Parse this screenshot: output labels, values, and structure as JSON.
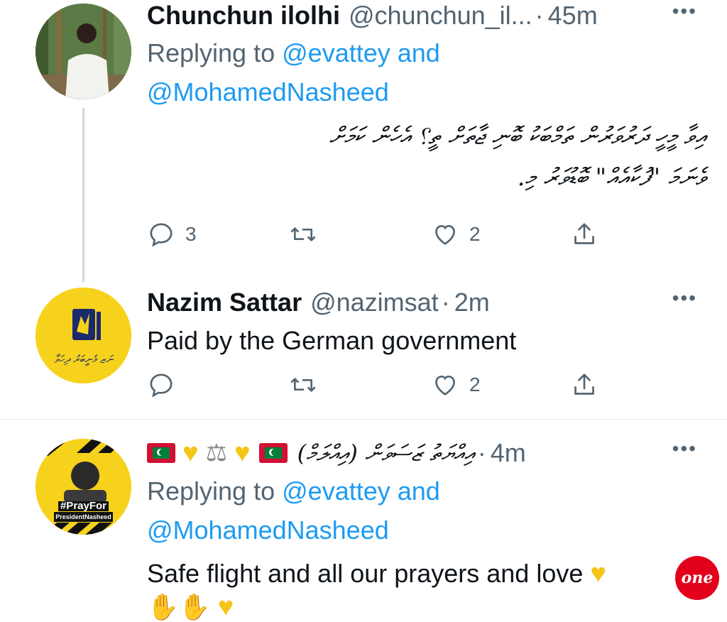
{
  "tweets": [
    {
      "name": "Chunchun ilolhi",
      "handle": "@chunchun_il...",
      "time": "45m",
      "replying_prefix": "Replying to",
      "replying_user1": "@evattey",
      "replying_and": "and",
      "replying_user2": "@MohamedNasheed",
      "text_line1": "އިވާ މީހީ ދަރުވަރުން ތަމްބަކު ބޮނި ޖާތަށް ތީ؟ އެހެން ކަމަށް",
      "text_line2": "ވެނަމަ \"ފުކާއެއް\" ބޮޑުވަރު މި.",
      "replies": "3",
      "retweets": "",
      "likes": "2"
    },
    {
      "name": "Nazim Sattar",
      "handle": "@nazimsat",
      "time": "2m",
      "text": "Paid by the German government",
      "avatar_text": "ނަޒ މެނީބަރު ދިހަވާ",
      "replies": "",
      "retweets": "",
      "likes": "2"
    },
    {
      "name": "އިއްޔަތު ޒަސަވަން (އިއްލަމް)",
      "time": "4m",
      "replying_prefix": "Replying to",
      "replying_user1": "@evattey",
      "replying_and": "and",
      "replying_user2": "@MohamedNasheed",
      "text": "Safe flight and all our prayers and love",
      "avatar_text1": "#PrayFor",
      "avatar_text2": "PresidentNasheed"
    }
  ],
  "icons": {
    "more": "more-horizontal-icon",
    "reply": "reply-icon",
    "retweet": "retweet-icon",
    "like": "heart-icon",
    "share": "share-icon"
  },
  "more_glyph": "•••",
  "dot_glyph": "·",
  "badge_text": "one",
  "colors": {
    "link": "#1d9bf0",
    "secondary": "#536471",
    "avatar_yellow": "#f6d21c",
    "heart_emoji": "#f5c518"
  }
}
